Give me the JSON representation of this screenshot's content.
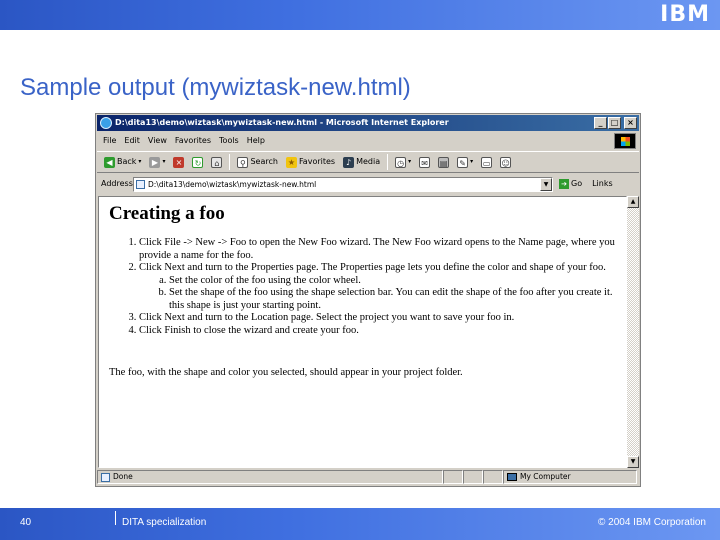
{
  "slide": {
    "logo": "IBM",
    "title": "Sample output (mywiztask-new.html)",
    "page_number": "40",
    "footer_left": "DITA specialization",
    "footer_right": "© 2004 IBM Corporation"
  },
  "browser": {
    "window_title": "D:\\dita13\\demo\\wiztask\\mywiztask-new.html - Microsoft Internet Explorer",
    "window_buttons": {
      "minimize": "_",
      "maximize": "□",
      "close": "×"
    },
    "menu": [
      "File",
      "Edit",
      "View",
      "Favorites",
      "Tools",
      "Help"
    ],
    "toolbar": {
      "back": "Back",
      "search": "Search",
      "favorites": "Favorites",
      "media": "Media"
    },
    "address_label": "Address",
    "address_value": "D:\\dita13\\demo\\wiztask\\mywiztask-new.html",
    "go_label": "Go",
    "links_label": "Links",
    "status_left": "Done",
    "status_zone": "My Computer"
  },
  "document": {
    "title": "Creating a foo",
    "steps": [
      "Click File -> New -> Foo to open the New Foo wizard. The New Foo wizard opens to the Name page, where you provide a name for the foo.",
      "Click Next and turn to the Properties page. The Properties page lets you define the color and shape of your foo.",
      "Click Next and turn to the Location page. Select the project you want to save your foo in.",
      "Click Finish to close the wizard and create your foo."
    ],
    "substeps": [
      "Set the color of the foo using the color wheel.",
      "Set the shape of the foo using the shape selection bar. You can edit the shape of the foo after you create it. this shape is just your starting point."
    ],
    "result": "The foo, with the shape and color you selected, should appear in your project folder."
  },
  "colors": {
    "slide_bar": "#3f6fe0",
    "slide_title": "#3a63c7",
    "titlebar_start": "#0a246a",
    "titlebar_end": "#3a6ea5",
    "window_face": "#d4d0c8"
  }
}
